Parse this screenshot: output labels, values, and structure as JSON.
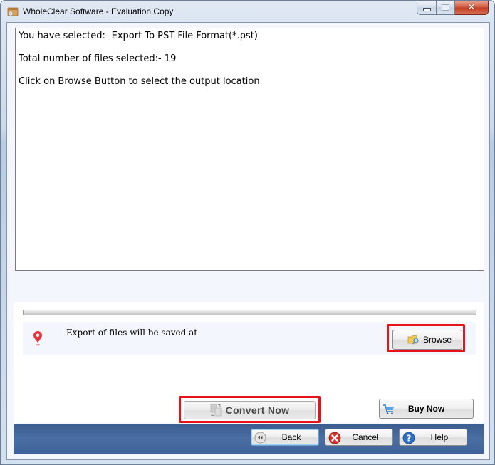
{
  "window": {
    "title": "WholeClear Software - Evaluation Copy",
    "app_icon": "software-box-icon",
    "controls": {
      "minimize_icon": "minimize-icon",
      "maximize_icon": "maximize-icon",
      "close_icon": "close-icon",
      "close_glyph": "✕"
    }
  },
  "info": {
    "lines": [
      "You have selected:- Export To PST File Format(*.pst)",
      "Total number of files selected:- 19",
      "Click on Browse Button to select the output location"
    ]
  },
  "progress": {
    "value_percent": 0
  },
  "save_location": {
    "label": "Export of files will be saved at",
    "icon": "location-pin-icon",
    "browse_label": "Browse",
    "browse_icon": "folder-search-icon"
  },
  "actions": {
    "convert_label": "Convert Now",
    "convert_icon": "convert-files-icon",
    "buy_label": "Buy Now",
    "buy_icon": "shopping-cart-icon"
  },
  "navigation": {
    "back_label": "Back",
    "back_icon": "rewind-icon",
    "cancel_label": "Cancel",
    "cancel_icon": "cancel-icon",
    "help_label": "Help",
    "help_icon": "help-icon"
  },
  "colors": {
    "highlight": "#e8131a",
    "bottom_bar": "#3f629a",
    "pin": "#e8313a"
  }
}
